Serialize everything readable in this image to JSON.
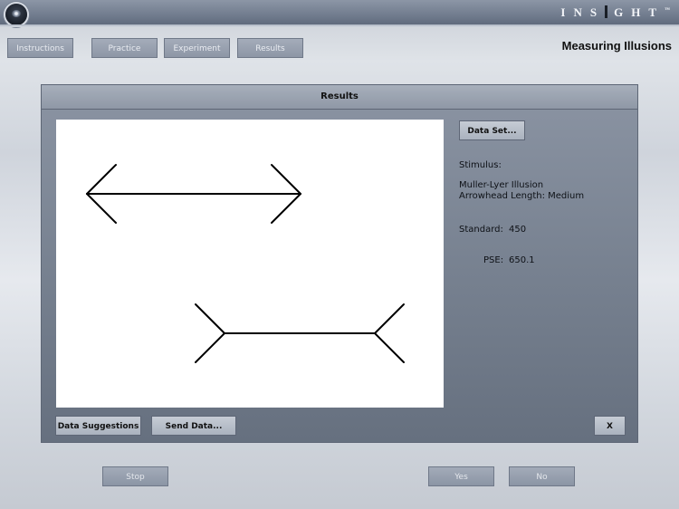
{
  "app": {
    "logo_text": "INS",
    "logo_text_tail": "GHT",
    "logo_tm": "™"
  },
  "nav": {
    "tabs": [
      {
        "label": "Instructions"
      },
      {
        "label": "Practice"
      },
      {
        "label": "Experiment"
      },
      {
        "label": "Results"
      }
    ],
    "page_title": "Measuring Illusions"
  },
  "results_panel": {
    "title": "Results",
    "data_set_button": "Data Set...",
    "stimulus_label": "Stimulus:",
    "stimulus_name": "Muller-Lyer Illusion",
    "arrowhead": "Arrowhead Length: Medium",
    "standard_label": "Standard:",
    "standard_value": "450",
    "pse_label": "PSE:",
    "pse_value": "650.1",
    "data_suggestions_button": "Data Suggestions",
    "send_data_button": "Send Data...",
    "close_button": "X"
  },
  "bottom": {
    "stop_button": "Stop",
    "yes_button": "Yes",
    "no_button": "No"
  },
  "colors": {
    "panel": "#7a8494",
    "canvas": "#ffffff",
    "stroke": "#000000"
  }
}
